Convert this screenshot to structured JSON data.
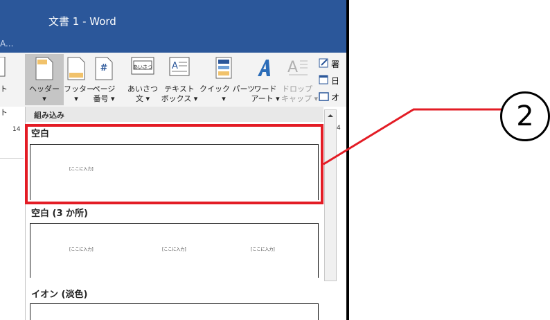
{
  "window": {
    "title": "文書 1 - Word",
    "subtitle": "A..."
  },
  "ribbon": {
    "buttons": [
      {
        "line1": "ヘッダー",
        "line2": "▾"
      },
      {
        "line1": "フッター",
        "line2": "▾"
      },
      {
        "line1": "ページ",
        "line2": "番号 ▾"
      },
      {
        "line1": "あいさつ",
        "line2": "文 ▾"
      },
      {
        "line1": "テキスト",
        "line2": "ボックス ▾"
      },
      {
        "line1": "クイック パーツ",
        "line2": "▾"
      },
      {
        "line1": "ワード",
        "line2": "アート ▾"
      },
      {
        "line1": "ドロップ",
        "line2": "キャップ ▾"
      }
    ],
    "side_items": [
      "署",
      "日",
      "オ"
    ],
    "page_number_glyph": "#",
    "greeting_glyph": "あいさつ",
    "left_cut_label": "ト",
    "left_cut_label2": "ト"
  },
  "gallery": {
    "section": "組み込み",
    "ruler_left": "14",
    "ruler_right": "4",
    "items": [
      {
        "name": "空白",
        "placeholders": [
          "[ここに入力]"
        ]
      },
      {
        "name": "空白 (3 か所)",
        "placeholders": [
          "[ここに入力]",
          "[ここに入力]",
          "[ここに入力]"
        ]
      },
      {
        "name": "イオン (淡色)",
        "placeholders": []
      }
    ]
  },
  "callout": {
    "number": "2"
  },
  "colors": {
    "title_bar": "#2b579a",
    "highlight": "#e31c25",
    "selected_button": "#c5c5c5"
  }
}
